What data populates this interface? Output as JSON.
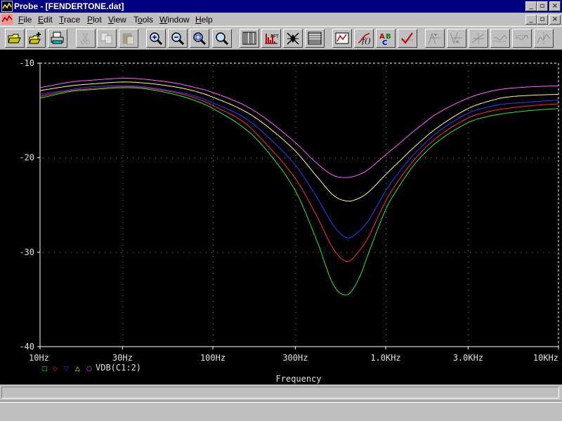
{
  "window": {
    "title": "Probe - [FENDERTONE.dat]",
    "controls": {
      "minimize": "_",
      "maximize": "▫",
      "close": "×"
    }
  },
  "menu": [
    {
      "label": "File",
      "mnemonic": "F"
    },
    {
      "label": "Edit",
      "mnemonic": "E"
    },
    {
      "label": "Trace",
      "mnemonic": "T"
    },
    {
      "label": "Plot",
      "mnemonic": "P"
    },
    {
      "label": "View",
      "mnemonic": "V"
    },
    {
      "label": "Tools",
      "mnemonic": "o"
    },
    {
      "label": "Window",
      "mnemonic": "W"
    },
    {
      "label": "Help",
      "mnemonic": "H"
    }
  ],
  "toolbar": [
    {
      "name": "open-file-icon",
      "enabled": true
    },
    {
      "name": "append-file-icon",
      "enabled": true
    },
    {
      "name": "print-icon",
      "enabled": true
    },
    {
      "name": "cut-icon",
      "enabled": false
    },
    {
      "name": "copy-icon",
      "enabled": false
    },
    {
      "name": "paste-icon",
      "enabled": false
    },
    {
      "name": "zoom-in-icon",
      "enabled": true
    },
    {
      "name": "zoom-out-icon",
      "enabled": true
    },
    {
      "name": "zoom-area-icon",
      "enabled": true
    },
    {
      "name": "zoom-fit-icon",
      "enabled": true
    },
    {
      "name": "log-x-axis-icon",
      "enabled": true
    },
    {
      "name": "fourier-icon",
      "enabled": true
    },
    {
      "name": "performance-analysis-icon",
      "enabled": true
    },
    {
      "name": "log-y-axis-icon",
      "enabled": true
    },
    {
      "name": "add-trace-icon",
      "enabled": true
    },
    {
      "name": "eval-goal-function-icon",
      "enabled": true
    },
    {
      "name": "text-label-icon",
      "enabled": true
    },
    {
      "name": "mark-data-points-icon",
      "enabled": true
    },
    {
      "name": "cursor-peak-icon",
      "enabled": false
    },
    {
      "name": "cursor-trough-icon",
      "enabled": false
    },
    {
      "name": "cursor-slope-icon",
      "enabled": false
    },
    {
      "name": "cursor-min-icon",
      "enabled": false
    },
    {
      "name": "cursor-max-icon",
      "enabled": false
    },
    {
      "name": "cursor-point-icon",
      "enabled": false
    }
  ],
  "colors": {
    "plot_background": "#000000",
    "axis": "#ffffff",
    "grid": "#909090",
    "green": "#2ee82e",
    "red": "#ff3030",
    "blue": "#3a3aff",
    "yellow": "#ffff80",
    "magenta": "#ff60ff"
  },
  "chart_data": {
    "type": "line",
    "x_scale": "log",
    "xlim": [
      10,
      10000
    ],
    "ylim": [
      -40,
      -10
    ],
    "xlabel": "Frequency",
    "x_ticks": [
      {
        "value": 10,
        "label": "10Hz"
      },
      {
        "value": 30,
        "label": "30Hz"
      },
      {
        "value": 100,
        "label": "100Hz"
      },
      {
        "value": 300,
        "label": "300Hz"
      },
      {
        "value": 1000,
        "label": "1.0KHz"
      },
      {
        "value": 3000,
        "label": "3.0KHz"
      },
      {
        "value": 10000,
        "label": "10KHz"
      }
    ],
    "y_ticks": [
      {
        "value": -10,
        "label": "-10"
      },
      {
        "value": -20,
        "label": "-20"
      },
      {
        "value": -30,
        "label": "-30"
      },
      {
        "value": -40,
        "label": "-40"
      }
    ],
    "grid": true,
    "legend": {
      "position": "bottom-left",
      "markers": [
        "□",
        "◇",
        "▽",
        "△",
        "○"
      ],
      "label": "VDB(C1:2)"
    },
    "x": [
      10,
      15,
      20,
      30,
      40,
      60,
      80,
      100,
      150,
      200,
      300,
      400,
      500,
      600,
      700,
      800,
      1000,
      1200,
      1500,
      2000,
      3000,
      4000,
      5000,
      7000,
      10000
    ],
    "series": [
      {
        "color": "green",
        "values": [
          -13.7,
          -13.0,
          -12.8,
          -12.6,
          -12.7,
          -13.3,
          -14.0,
          -14.8,
          -16.8,
          -19.0,
          -23.5,
          -28.8,
          -33.5,
          -34.5,
          -32.8,
          -30.0,
          -25.5,
          -23.0,
          -20.5,
          -18.3,
          -16.3,
          -15.6,
          -15.3,
          -15.0,
          -14.8
        ]
      },
      {
        "color": "red",
        "values": [
          -13.5,
          -12.9,
          -12.7,
          -12.5,
          -12.6,
          -13.1,
          -13.7,
          -14.5,
          -16.2,
          -18.4,
          -22.2,
          -26.2,
          -29.7,
          -31.0,
          -29.9,
          -28.3,
          -24.6,
          -22.3,
          -20.0,
          -17.8,
          -15.8,
          -15.1,
          -14.8,
          -14.5,
          -14.3
        ]
      },
      {
        "color": "blue",
        "values": [
          -13.3,
          -12.8,
          -12.5,
          -12.4,
          -12.5,
          -13.0,
          -13.5,
          -14.2,
          -15.7,
          -17.5,
          -20.8,
          -24.2,
          -27.2,
          -28.5,
          -27.8,
          -26.6,
          -23.5,
          -21.5,
          -19.4,
          -17.3,
          -15.3,
          -14.6,
          -14.3,
          -14.1,
          -13.9
        ]
      },
      {
        "color": "yellow",
        "values": [
          -12.9,
          -12.4,
          -12.2,
          -12.0,
          -12.1,
          -12.5,
          -13.0,
          -13.6,
          -15.0,
          -16.5,
          -19.3,
          -22.0,
          -24.0,
          -24.6,
          -24.3,
          -23.6,
          -21.8,
          -20.4,
          -18.7,
          -16.8,
          -14.8,
          -14.0,
          -13.6,
          -13.4,
          -13.3
        ]
      },
      {
        "color": "magenta",
        "values": [
          -12.6,
          -12.0,
          -11.8,
          -11.6,
          -11.7,
          -12.1,
          -12.6,
          -13.1,
          -14.4,
          -15.8,
          -18.4,
          -20.6,
          -21.9,
          -22.1,
          -21.8,
          -21.2,
          -19.7,
          -18.5,
          -17.0,
          -15.3,
          -13.7,
          -13.0,
          -12.7,
          -12.5,
          -12.4
        ]
      }
    ]
  }
}
